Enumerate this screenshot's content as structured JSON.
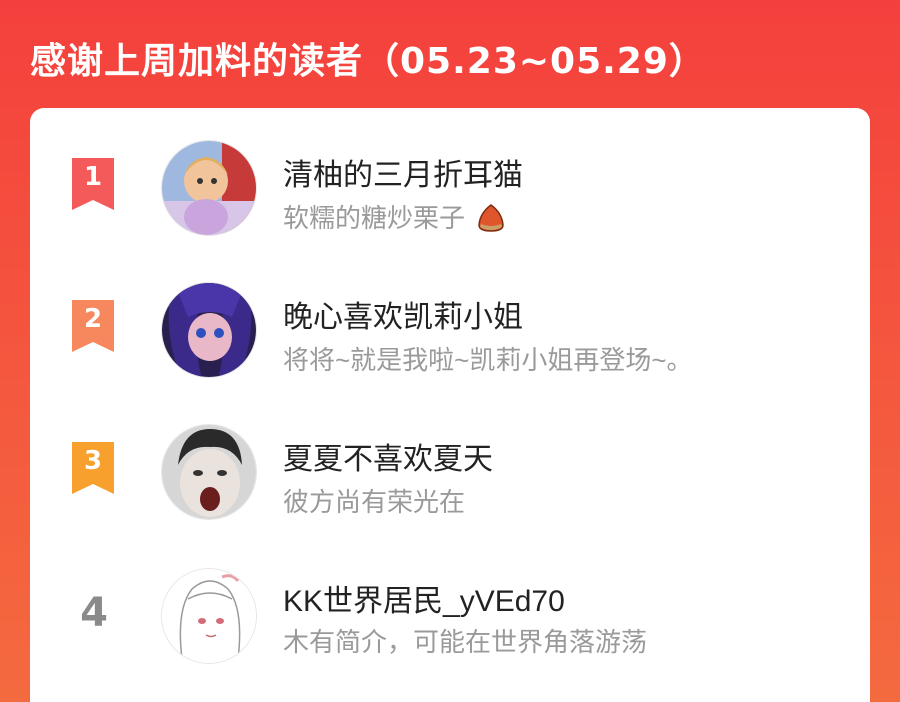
{
  "header": {
    "title": "感谢上周加料的读者（05.23~05.29）"
  },
  "colors": {
    "rank1": "#f55a5a",
    "rank2": "#f7875c",
    "rank3": "#f8a02d",
    "rank_other": "#8a8a8a"
  },
  "readers": [
    {
      "rank": "1",
      "name": "清柚的三月折耳猫",
      "bio": "软糯的糖炒栗子",
      "bio_icon": "chestnut-icon",
      "avatar": "cartoon-girl-avatar"
    },
    {
      "rank": "2",
      "name": "晚心喜欢凯莉小姐",
      "bio": "将将~就是我啦~凯莉小姐再登场~。",
      "avatar": "anime-girl-avatar"
    },
    {
      "rank": "3",
      "name": "夏夏不喜欢夏天",
      "bio": "彼方尚有荣光在",
      "avatar": "photo-avatar"
    },
    {
      "rank": "4",
      "name": "KK世界居民_yVEd70",
      "bio": "木有简介，可能在世界角落游荡",
      "avatar": "sketch-girl-avatar"
    }
  ]
}
